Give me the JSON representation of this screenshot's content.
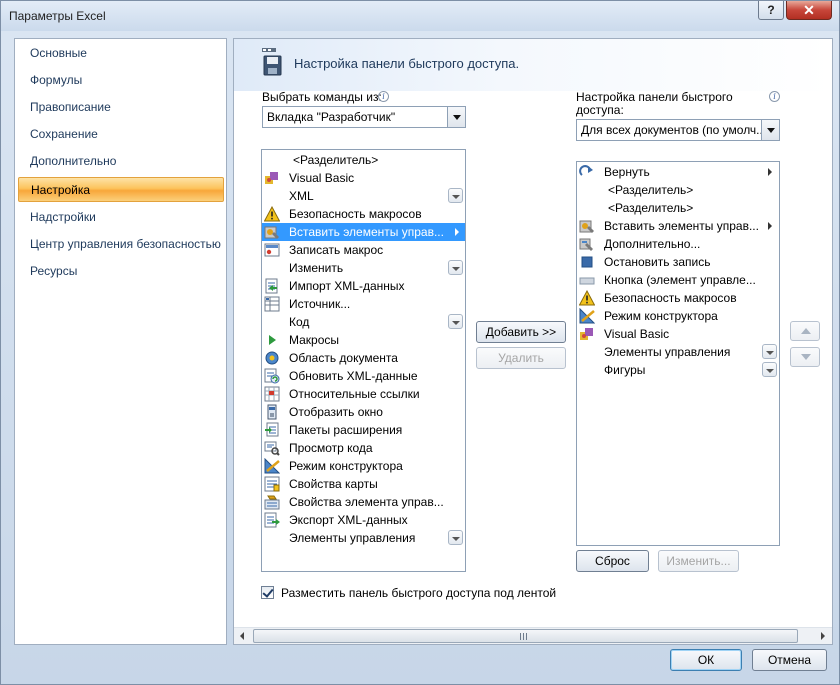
{
  "window": {
    "title": "Параметры Excel",
    "help_glyph": "?",
    "close_glyph": "✕"
  },
  "sidebar": {
    "items": [
      {
        "label": "Основные"
      },
      {
        "label": "Формулы"
      },
      {
        "label": "Правописание"
      },
      {
        "label": "Сохранение"
      },
      {
        "label": "Дополнительно"
      },
      {
        "label": "Настройка",
        "selected": true
      },
      {
        "label": "Надстройки"
      },
      {
        "label": "Центр управления безопасностью"
      },
      {
        "label": "Ресурсы"
      }
    ]
  },
  "header": {
    "title": "Настройка панели быстрого доступа.",
    "icon": "quick-access-toolbar-icon"
  },
  "choose_commands": {
    "label": "Выбрать команды из:",
    "value": "Вкладка \"Разработчик\""
  },
  "customize_toolbar": {
    "label_line1": "Настройка панели быстрого",
    "label_line2": "доступа:",
    "value": "Для всех документов (по умолч..."
  },
  "commands_list": [
    {
      "label": "<Разделитель>",
      "icon": "",
      "separator": true
    },
    {
      "label": "Visual Basic",
      "icon": "visual-basic-icon"
    },
    {
      "label": "XML",
      "icon": "",
      "dropdown": true
    },
    {
      "label": "Безопасность макросов",
      "icon": "warning-icon"
    },
    {
      "label": "Вставить элементы управ...",
      "icon": "insert-controls-icon",
      "submenu": true,
      "selected": true
    },
    {
      "label": "Записать макрос",
      "icon": "record-macro-icon"
    },
    {
      "label": "Изменить",
      "icon": "",
      "dropdown": true
    },
    {
      "label": "Импорт XML-данных",
      "icon": "xml-import-icon"
    },
    {
      "label": "Источник...",
      "icon": "xml-source-icon"
    },
    {
      "label": "Код",
      "icon": "",
      "dropdown": true
    },
    {
      "label": "Макросы",
      "icon": "play-macro-icon"
    },
    {
      "label": "Область документа",
      "icon": "document-panel-icon"
    },
    {
      "label": "Обновить XML-данные",
      "icon": "refresh-xml-icon"
    },
    {
      "label": "Относительные ссылки",
      "icon": "relative-references-icon"
    },
    {
      "label": "Отобразить окно",
      "icon": "show-window-icon"
    },
    {
      "label": "Пакеты расширения",
      "icon": "expansion-packs-icon"
    },
    {
      "label": "Просмотр кода",
      "icon": "view-code-icon"
    },
    {
      "label": "Режим конструктора",
      "icon": "design-mode-icon"
    },
    {
      "label": "Свойства карты",
      "icon": "map-properties-icon"
    },
    {
      "label": "Свойства элемента управ...",
      "icon": "control-properties-icon"
    },
    {
      "label": "Экспорт XML-данных",
      "icon": "xml-export-icon"
    },
    {
      "label": "Элементы управления",
      "icon": "",
      "dropdown": true
    }
  ],
  "toolbar_list": [
    {
      "label": "Вернуть",
      "icon": "redo-icon",
      "submenu": true
    },
    {
      "label": "<Разделитель>",
      "icon": "",
      "separator": true
    },
    {
      "label": "<Разделитель>",
      "icon": "",
      "separator": true
    },
    {
      "label": "Вставить элементы управ...",
      "icon": "insert-controls-icon",
      "submenu": true
    },
    {
      "label": "Дополнительно...",
      "icon": "more-icon"
    },
    {
      "label": "Остановить запись",
      "icon": "stop-recording-icon"
    },
    {
      "label": "Кнопка (элемент управле...",
      "icon": "button-control-icon"
    },
    {
      "label": "Безопасность макросов",
      "icon": "warning-icon"
    },
    {
      "label": "Режим конструктора",
      "icon": "design-mode-icon"
    },
    {
      "label": "Visual Basic",
      "icon": "visual-basic-icon"
    },
    {
      "label": "Элементы управления",
      "icon": "",
      "dropdown": true
    },
    {
      "label": "Фигуры",
      "icon": "",
      "dropdown": true
    }
  ],
  "buttons": {
    "add": "Добавить >>",
    "remove": "Удалить",
    "reset": "Сброс",
    "modify": "Изменить...",
    "ok": "ОК",
    "cancel": "Отмена"
  },
  "below_ribbon": {
    "checked": true,
    "label": "Разместить панель быстрого доступа под лентой"
  },
  "colors": {
    "selection": "#3399ff",
    "sidebar_selected": "#fcc35c",
    "accent_text": "#1e395b"
  }
}
